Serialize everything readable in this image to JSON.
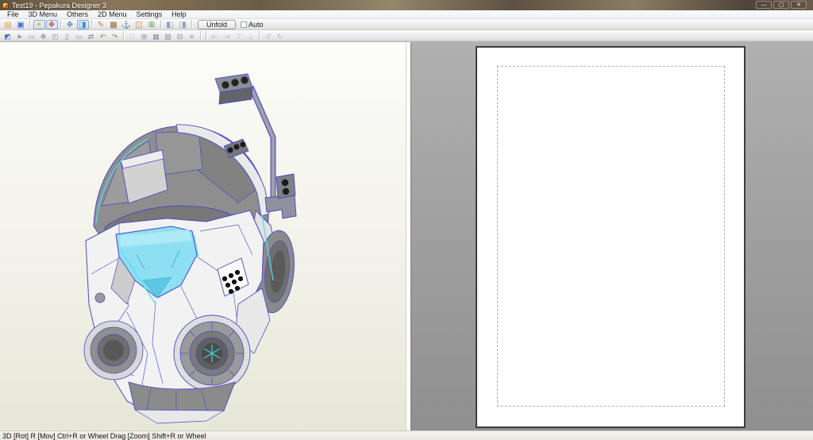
{
  "window": {
    "title": "Test19 - Pepakura Designer 3",
    "controls": {
      "minimize": "—",
      "maximize": "▢",
      "close": "✕"
    }
  },
  "menu": {
    "items": [
      {
        "label": "File"
      },
      {
        "label": "3D Menu"
      },
      {
        "label": "Others"
      },
      {
        "label": "2D Menu"
      },
      {
        "label": "Settings"
      },
      {
        "label": "Help"
      }
    ]
  },
  "toolbar_main": {
    "unfold_label": "Unfold",
    "auto_label": "Auto",
    "icons": [
      {
        "name": "open-file-icon",
        "glyph": "▤",
        "color": "#e0a23c"
      },
      {
        "name": "save-icon",
        "glyph": "▣",
        "color": "#3d6fd8"
      },
      {
        "name": "light-toggle-icon",
        "glyph": "☀",
        "color": "#e3b31f",
        "pressed": true
      },
      {
        "name": "material-view-icon",
        "glyph": "❖",
        "color": "#c84a3a",
        "pressed": true
      },
      {
        "name": "rotate-3d-icon",
        "glyph": "✥",
        "color": "#4a86c8"
      },
      {
        "name": "view-2d-icon",
        "glyph": "◨",
        "color": "#4a86c8",
        "pressed": true
      },
      {
        "name": "edit-mode-icon",
        "glyph": "✎",
        "color": "#c8863d"
      },
      {
        "name": "texture-box-icon",
        "glyph": "▩",
        "color": "#9a6a3d"
      },
      {
        "name": "anchor-icon",
        "glyph": "⚓",
        "color": "#3d6fd8"
      },
      {
        "name": "image-icon",
        "glyph": "◫",
        "color": "#c87a3d"
      },
      {
        "name": "node-link-icon",
        "glyph": "⊞",
        "color": "#4aa84a"
      },
      {
        "name": "layout-left-icon",
        "glyph": "◧",
        "color": "#8aa0b8"
      },
      {
        "name": "layout-right-icon",
        "glyph": "◨",
        "color": "#8aa0b8"
      }
    ]
  },
  "toolbar_edit": {
    "icons": [
      {
        "name": "select-part-icon",
        "glyph": "◩",
        "color": "#4a6fc8"
      },
      {
        "name": "lasso-select-icon",
        "glyph": "➤",
        "color": "#8a8f98"
      },
      {
        "name": "rect-select-icon",
        "glyph": "▭",
        "color": "#8a8f98"
      },
      {
        "name": "move-island-icon",
        "glyph": "✥",
        "color": "#8a8f98"
      },
      {
        "name": "part-page-icon",
        "glyph": "◰",
        "color": "#8a8f98"
      },
      {
        "name": "page-blank-icon",
        "glyph": "▯",
        "color": "#8a8f98"
      },
      {
        "name": "page-wide-icon",
        "glyph": "▭",
        "color": "#8a8f98"
      },
      {
        "name": "flip-icon",
        "glyph": "⇄",
        "color": "#8a8f98"
      },
      {
        "name": "rotate-left-icon",
        "glyph": "↶",
        "color": "#b07a3a"
      },
      {
        "name": "rotate-right-icon",
        "glyph": "↷",
        "color": "#b07a3a"
      },
      {
        "name": "divide-face-icon",
        "glyph": "∷",
        "color": "#8a8f98"
      },
      {
        "name": "join-edge-icon",
        "glyph": "⊞",
        "color": "#8a8f98"
      },
      {
        "name": "thumbnail-icon",
        "glyph": "▦",
        "color": "#8a8f98"
      },
      {
        "name": "texture-map-icon",
        "glyph": "▧",
        "color": "#8a8f98"
      },
      {
        "name": "print-icon",
        "glyph": "⊟",
        "color": "#8a8f98"
      },
      {
        "name": "export-icon",
        "glyph": "≡",
        "color": "#8a8f98"
      },
      {
        "name": "align-left-icon",
        "glyph": "⇤",
        "color": "#bdbdbd"
      },
      {
        "name": "align-right-icon",
        "glyph": "⇥",
        "color": "#bdbdbd"
      },
      {
        "name": "align-top-icon",
        "glyph": "⊤",
        "color": "#bdbdbd"
      },
      {
        "name": "align-bottom-icon",
        "glyph": "⊥",
        "color": "#bdbdbd"
      },
      {
        "name": "undo-icon",
        "glyph": "↺",
        "color": "#bdbdbd"
      },
      {
        "name": "redo-icon",
        "glyph": "↻",
        "color": "#bdbdbd"
      }
    ]
  },
  "panes": {
    "viewer_3d": {
      "content": "helmet-3d-model"
    },
    "layout_2d": {
      "page_orientation": "portrait",
      "pattern_count": 0
    }
  },
  "status_bar": {
    "text": "3D [Rot] R [Mov] Ctrl+R or Wheel Drag [Zoom] Shift+R or Wheel"
  },
  "colors": {
    "visor_cyan": "#8edff2",
    "edge_blue": "#4a4ac6",
    "edge_cyan": "#54dfe8",
    "model_grey": "#8e8e8e",
    "pane2d_grey": "#a2a2a2",
    "pane3d_cream": "#efefe2"
  }
}
